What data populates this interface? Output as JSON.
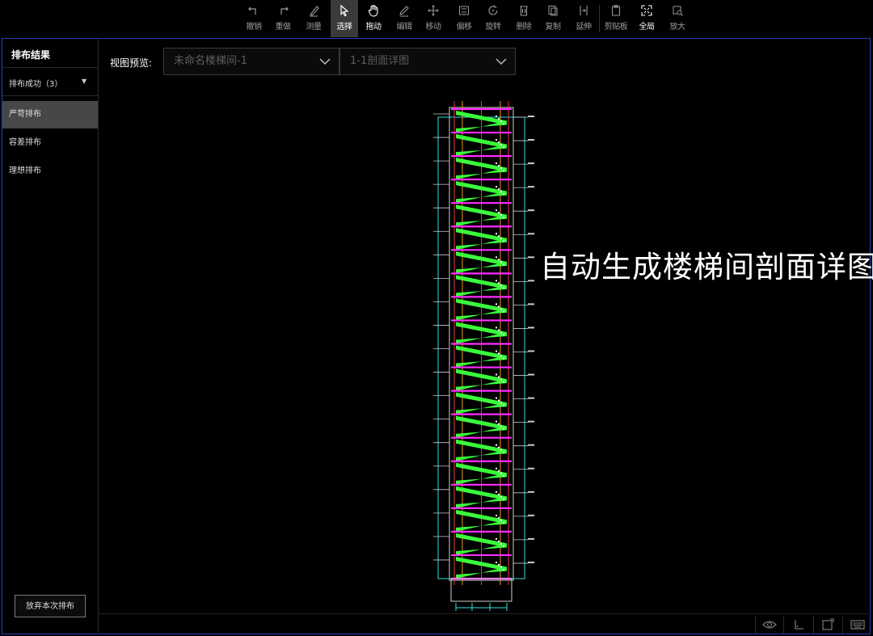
{
  "toolbar": {
    "items": [
      {
        "label": "撤销",
        "icon": "undo-icon"
      },
      {
        "label": "重做",
        "icon": "redo-icon"
      },
      {
        "label": "测量",
        "icon": "measure-icon"
      },
      {
        "label": "选择",
        "icon": "select-cursor-icon",
        "active": true
      },
      {
        "label": "拖动",
        "icon": "hand-drag-icon"
      },
      {
        "label": "编辑",
        "icon": "edit-pencil-icon"
      },
      {
        "label": "移动",
        "icon": "move-icon"
      },
      {
        "label": "偏移",
        "icon": "offset-icon"
      },
      {
        "label": "旋转",
        "icon": "rotate-icon"
      },
      {
        "label": "删除",
        "icon": "delete-icon"
      },
      {
        "label": "复制",
        "icon": "copy-icon"
      },
      {
        "label": "延伸",
        "icon": "extend-icon"
      },
      {
        "label": "剪贴板",
        "icon": "clipboard-icon"
      },
      {
        "label": "全局",
        "icon": "fit-all-icon"
      },
      {
        "label": "放大",
        "icon": "zoom-in-icon"
      }
    ]
  },
  "left_panel": {
    "title": "排布结果",
    "status": "排布成功（3）",
    "items": [
      {
        "label": "严苛排布",
        "selected": true
      },
      {
        "label": "容差排布",
        "selected": false
      },
      {
        "label": "理想排布",
        "selected": false
      }
    ],
    "discard_button": "放弃本次排布"
  },
  "view_preview": {
    "label": "视图预览:",
    "stair_select": "未命名楼梯间-1",
    "section_select": "1-1剖面详图"
  },
  "canvas": {
    "overlay_text": "自动生成楼梯间剖面详图",
    "floors": 20
  },
  "status_bar": {
    "icons": [
      "eye-icon",
      "axis-icon",
      "viewport-icon",
      "keyboard-icon"
    ]
  },
  "colors": {
    "accent_frame": "#2b3fb8",
    "drawing_green": "#39ff3a",
    "drawing_magenta": "#ff2cff",
    "drawing_cyan": "#2fe0e0",
    "drawing_red": "#e03a3a",
    "drawing_orange": "#e0a020"
  }
}
